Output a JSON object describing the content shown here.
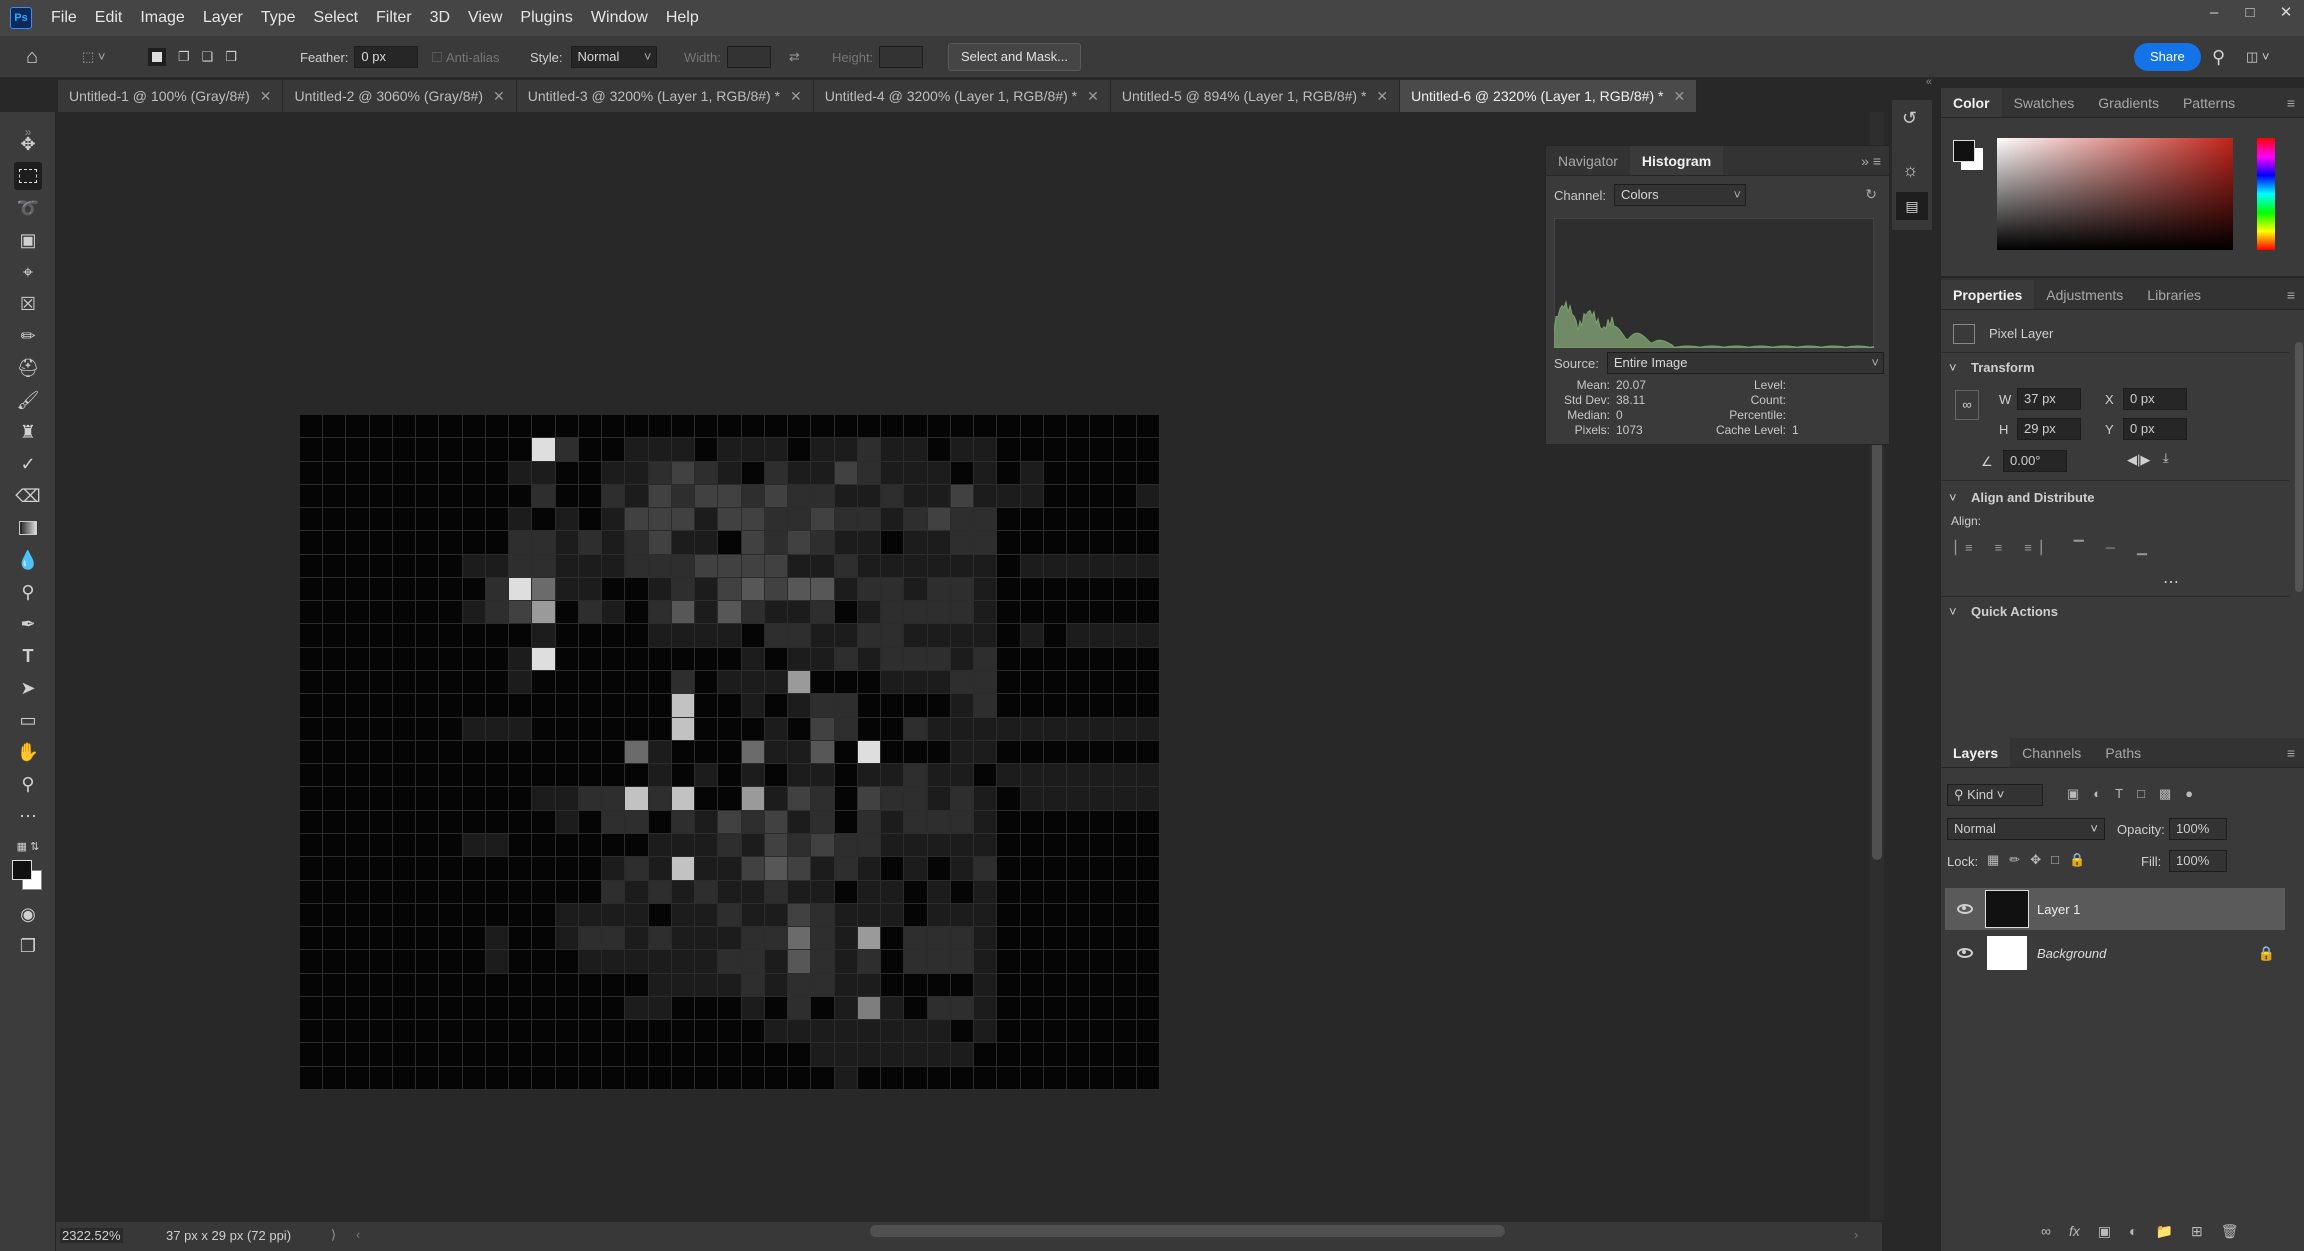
{
  "app": {
    "logo": "Ps"
  },
  "menu": [
    "File",
    "Edit",
    "Image",
    "Layer",
    "Type",
    "Select",
    "Filter",
    "3D",
    "View",
    "Plugins",
    "Window",
    "Help"
  ],
  "options": {
    "feather_label": "Feather:",
    "feather_value": "0 px",
    "antialias_label": "Anti-alias",
    "style_label": "Style:",
    "style_value": "Normal",
    "width_label": "Width:",
    "height_label": "Height:",
    "select_mask": "Select and Mask...",
    "share": "Share"
  },
  "tabs": [
    {
      "label": "Untitled-1 @ 100% (Gray/8#)"
    },
    {
      "label": "Untitled-2 @ 3060% (Gray/8#)"
    },
    {
      "label": "Untitled-3 @ 3200% (Layer 1, RGB/8#) *"
    },
    {
      "label": "Untitled-4 @ 3200% (Layer 1, RGB/8#) *"
    },
    {
      "label": "Untitled-5 @ 894% (Layer 1, RGB/8#) *"
    },
    {
      "label": "Untitled-6 @ 2320% (Layer 1, RGB/8#) *"
    }
  ],
  "status": {
    "zoom": "2322.52%",
    "doc_size": "37 px x 29 px (72 ppi)"
  },
  "histogram": {
    "tab_navigator": "Navigator",
    "tab_histogram": "Histogram",
    "channel_label": "Channel:",
    "channel_value": "Colors",
    "source_label": "Source:",
    "source_value": "Entire Image",
    "mean_label": "Mean:",
    "mean": "20.07",
    "stddev_label": "Std Dev:",
    "stddev": "38.11",
    "median_label": "Median:",
    "median": "0",
    "pixels_label": "Pixels:",
    "pixels": "1073",
    "level_label": "Level:",
    "count_label": "Count:",
    "percentile_label": "Percentile:",
    "cache_label": "Cache Level:",
    "cache": "1"
  },
  "color_panel": {
    "tabs": [
      "Color",
      "Swatches",
      "Gradients",
      "Patterns"
    ]
  },
  "properties": {
    "tabs": [
      "Properties",
      "Adjustments",
      "Libraries"
    ],
    "kind": "Pixel Layer",
    "transform": "Transform",
    "w_label": "W",
    "w": "37 px",
    "h_label": "H",
    "h": "29 px",
    "x_label": "X",
    "x": "0 px",
    "y_label": "Y",
    "y": "0 px",
    "angle": "0.00°",
    "align": "Align and Distribute",
    "align_label": "Align:",
    "quick": "Quick Actions"
  },
  "layers_panel": {
    "tabs": [
      "Layers",
      "Channels",
      "Paths"
    ],
    "kind": "Kind",
    "blend": "Normal",
    "opacity_label": "Opacity:",
    "opacity": "100%",
    "lock_label": "Lock:",
    "fill_label": "Fill:",
    "fill": "100%",
    "layers": [
      {
        "name": "Layer 1"
      },
      {
        "name": "Background"
      }
    ]
  },
  "pixels": [
    "0000000000000000000000000000000000000",
    "0000000000920011101110112110110000000",
    "0000000001100112321021132111010100000",
    "0000000000200213233232211211311100001",
    "0000000001010133313322322123220000000",
    "0000000002212123110323211011220000000",
    "0000000112211122233331121111110111111",
    "0000000029511001213434412212210000000",
    "0000000123702102414211201222210000000",
    "0000000000100001111022112211110101111",
    "0000000001900000000101121222120000000",
    "0000000001000000201117000111220000000",
    "0000000000000000800101220000120000000",
    "0000000111000000800010320021111111111",
    "0000000000000051000511409000110000000",
    "0000000000000001010101101121101111111",
    "0000000000112282800713203221210111111",
    "0000000000010220213231202122210000000",
    "0000000110000001112132322111110000000",
    "0000000000000121811343121010120000000",
    "0000000000000212121121101101010000000",
    "0000000000011110112113211101110000000",
    "0000000010012212111225217022210000000",
    "0000000010001111112214212022210000000",
    "0000000000000001111212211000010000000",
    "0000000000000011000102016102210000000",
    "0000000000000000000011111111010000000",
    "0000000000000000000000111111100000000",
    "0000000000000000000000010000000000000"
  ]
}
